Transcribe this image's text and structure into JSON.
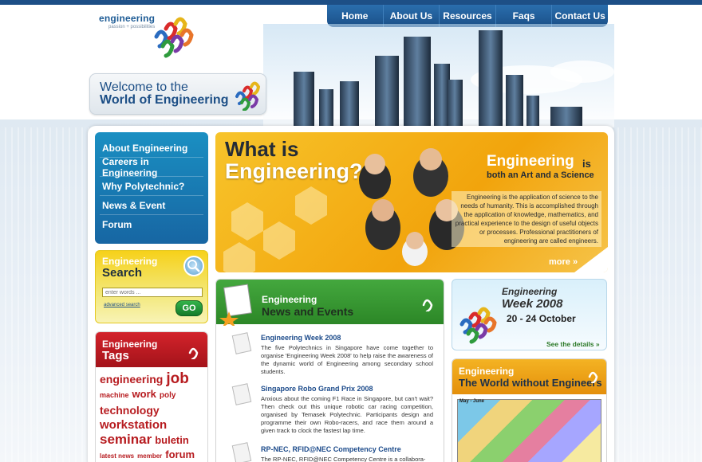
{
  "logo": {
    "word": "engineering",
    "tagline": "passion + possibilities"
  },
  "nav": {
    "items": [
      "Home",
      "About Us",
      "Resources",
      "Faqs",
      "Contact Us"
    ]
  },
  "welcome": {
    "line1": "Welcome to the",
    "line2": "World of Engineering"
  },
  "menu": {
    "items": [
      {
        "label": "About Engineering"
      },
      {
        "label": "Careers in Engineering"
      },
      {
        "label": "Why Polytechnic?"
      },
      {
        "label": "News & Event"
      },
      {
        "label": "Forum"
      }
    ]
  },
  "search": {
    "title1": "Engineering",
    "title2": "Search",
    "placeholder": "enter words ...",
    "advanced": "advanced search",
    "go": "GO"
  },
  "tags": {
    "title1": "Engineering",
    "title2": "Tags",
    "cloud": [
      {
        "t": "engineering"
      },
      {
        "t": "job"
      },
      {
        "t": "machine"
      },
      {
        "t": "work"
      },
      {
        "t": "poly"
      },
      {
        "t": "technology"
      },
      {
        "t": "workstation"
      },
      {
        "t": "seminar"
      },
      {
        "t": "buletin"
      },
      {
        "t": "latest news"
      },
      {
        "t": "member"
      },
      {
        "t": "forum"
      }
    ]
  },
  "hero": {
    "what": "What is",
    "eng": "Engineering?",
    "right_title": "Engineering",
    "right_is": "is",
    "right_sub": "both an Art and a Science",
    "desc": "Engineering is the application of science to the needs of humanity. This is accomplished through the application of knowledge, mathematics, and practical experience to the design of useful objects or processes. Professional practitioners of engineering are called engineers.",
    "more": "more »"
  },
  "news": {
    "title1": "Engineering",
    "title2": "News and Events",
    "items": [
      {
        "title": "Engineering Week 2008",
        "body": "The five Polytechnics in Singapore have come together to organise 'Engineering Week 2008' to help raise the awareness of the dynamic world of Engineering among secondary school students."
      },
      {
        "title": "Singapore Robo Grand Prix 2008",
        "body": "Anxious about the coming F1 Race in Singapore, but can't wait? Then check out this unique robotic car racing competition, organised by Temasek Polytechnic. Participants design and programme their own Robo-racers, and race them around a given track to clock the fastest lap time."
      },
      {
        "title": "RP-NEC, RFID@NEC Competency Centre",
        "body": "The RP-NEC, RFID@NEC Competency Centre is a collabora-"
      }
    ]
  },
  "week": {
    "title1": "Engineering",
    "title2": "Week 2008",
    "dates": "20 - 24 October",
    "see": "See the details »"
  },
  "world": {
    "title1": "Engineering",
    "title2": "The World without Engineers",
    "comic_label": "May - June"
  },
  "colors": {
    "brand_blue": "#1d4f86",
    "menu_blue": "#1a8fc2",
    "hero_yellow": "#f7c42b",
    "news_green": "#44a83e",
    "tags_red": "#d3232b",
    "world_orange": "#f4b323"
  }
}
